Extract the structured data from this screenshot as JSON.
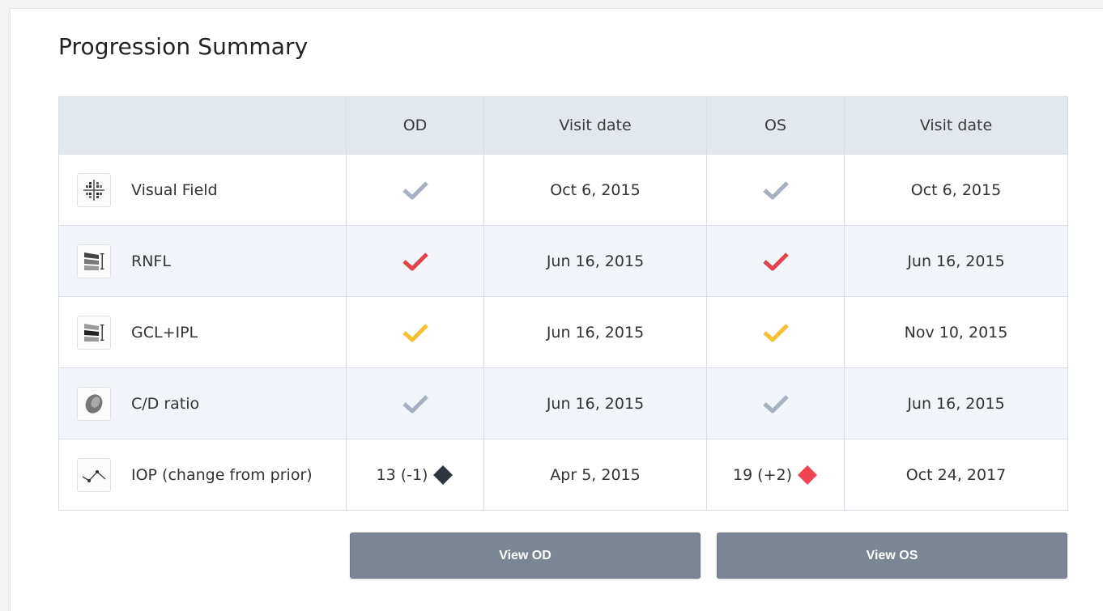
{
  "title": "Progression Summary",
  "colors": {
    "check_gray": "#a7b0c0",
    "check_red": "#e2434c",
    "check_yellow": "#f5c132",
    "diamond_dark": "#2f3540",
    "diamond_red": "#f04452",
    "button_bg": "#7c8595"
  },
  "table": {
    "headers": [
      "",
      "OD",
      "Visit date",
      "OS",
      "Visit date"
    ],
    "rows": [
      {
        "icon": "visual-field-icon",
        "label": "Visual Field",
        "od_status": "gray-check",
        "od_date": "Oct 6, 2015",
        "os_status": "gray-check",
        "os_date": "Oct 6, 2015"
      },
      {
        "icon": "rnfl-icon",
        "label": "RNFL",
        "od_status": "red-check",
        "od_date": "Jun 16, 2015",
        "os_status": "red-check",
        "os_date": "Jun 16, 2015"
      },
      {
        "icon": "gcl-ipl-icon",
        "label": "GCL+IPL",
        "od_status": "yellow-check",
        "od_date": "Jun 16, 2015",
        "os_status": "yellow-check",
        "os_date": "Nov 10, 2015"
      },
      {
        "icon": "cd-ratio-icon",
        "label": "C/D ratio",
        "od_status": "gray-check",
        "od_date": "Jun 16, 2015",
        "os_status": "gray-check",
        "os_date": "Jun 16, 2015"
      },
      {
        "icon": "iop-trend-icon",
        "label": "IOP (change from prior)",
        "od_value": "13",
        "od_change": "(-1)",
        "od_indicator": "dark-diamond-icon",
        "od_date": "Apr 5, 2015",
        "os_value": "19",
        "os_change": "(+2)",
        "os_indicator": "red-diamond-icon",
        "os_date": "Oct 24, 2017"
      }
    ]
  },
  "buttons": {
    "view_od": "View OD",
    "view_os": "View OS"
  }
}
